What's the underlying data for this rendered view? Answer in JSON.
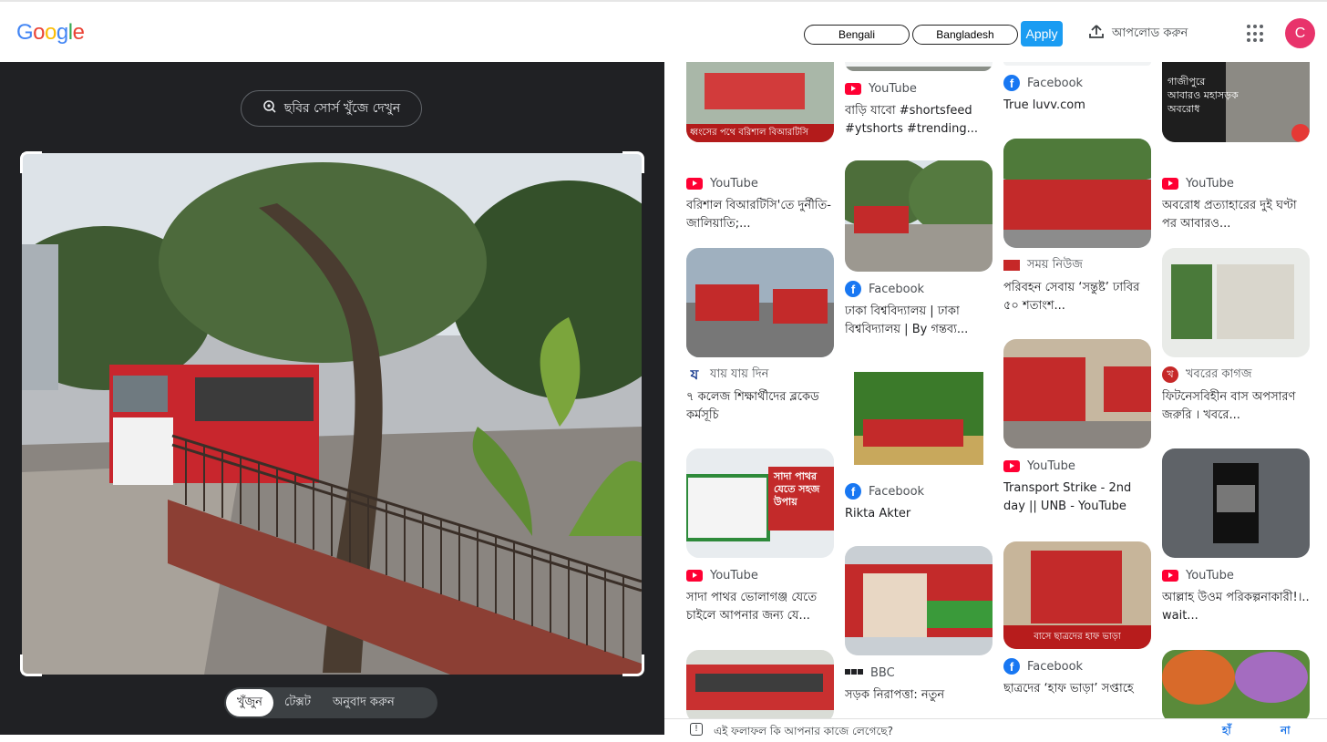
{
  "header": {
    "logo_text": "Google",
    "language_value": "Bengali",
    "region_value": "Bangladesh",
    "apply_label": "Apply",
    "upload_label": "আপলোড করুন",
    "avatar_letter": "C"
  },
  "left_panel": {
    "source_button_label": "ছবির সোর্স খুঁজে দেখুন",
    "tabs": [
      {
        "label": "খুঁজুন",
        "active": true
      },
      {
        "label": "টেক্সট",
        "active": false
      },
      {
        "label": "অনুবাদ করুন",
        "active": false
      }
    ]
  },
  "results": {
    "col1": [
      {
        "source": "",
        "icon": "none",
        "title": "",
        "caption": "ধ্বংসের পথে বরিশাল বিআরটিসি"
      },
      {
        "source": "YouTube",
        "icon": "youtube-icon",
        "title": "বরিশাল বিআরটিসি'তে দুর্নীতি-জালিয়াতি;..."
      },
      {
        "source": "যায় যায় দিন",
        "icon": "jaijaidin-icon",
        "title": "৭ কলেজ শিক্ষার্থীদের ব্লকেড কর্মসূচি"
      },
      {
        "source": "YouTube",
        "icon": "youtube-icon",
        "title": "সাদা পাথর ভোলাগঞ্জ যেতে চাইলে আপনার জন্য যে...",
        "caption": "সাদা পাথর যেতে সহজ উপায়"
      },
      {
        "source": "",
        "icon": "none",
        "title": ""
      }
    ],
    "col2": [
      {
        "source": "YouTube",
        "icon": "youtube-icon",
        "title": "বাড়ি যাবো #shortsfeed #ytshorts #trending..."
      },
      {
        "source": "Facebook",
        "icon": "facebook-icon",
        "title": "ঢাকা বিশ্ববিদ্যালয় | ঢাকা বিশ্ববিদ্যালয় | By গন্তব্য..."
      },
      {
        "source": "Facebook",
        "icon": "facebook-icon",
        "title": "Rikta Akter"
      },
      {
        "source": "BBC",
        "icon": "bbc-icon",
        "title": "সড়ক নিরাপত্তা: নতুন"
      }
    ],
    "col3": [
      {
        "source": "Facebook",
        "icon": "facebook-icon",
        "title": "True luvv.com"
      },
      {
        "source": "সময় নিউজ",
        "icon": "somoy-icon",
        "title": "পরিবহন সেবায় ‘সন্তুষ্ট’ ঢাবির ৫০ শতাংশ..."
      },
      {
        "source": "YouTube",
        "icon": "youtube-icon",
        "title": "Transport Strike - 2nd day || UNB - YouTube"
      },
      {
        "source": "Facebook",
        "icon": "facebook-icon",
        "title": "ছাত্রদের ‘হাফ ভাড়া’ সপ্তাহে",
        "caption": "বাসে ছাত্রদের হাফ ভাড়া"
      }
    ],
    "col4": [
      {
        "source": "",
        "icon": "none",
        "title": "",
        "caption": "গাজীপুরে আবারও মহাসড়ক অবরোধ"
      },
      {
        "source": "YouTube",
        "icon": "youtube-icon",
        "title": "অবরোধ প্রত্যাহারের দুই ঘণ্টা পর আবারও..."
      },
      {
        "source": "খবরের কাগজ",
        "icon": "khoborer-kagoj-icon",
        "title": "ফিটনেসবিহীন বাস অপসারণ জরুরি । খবরে..."
      },
      {
        "source": "YouTube",
        "icon": "youtube-icon",
        "title": "আল্লাহ উওম পরিকল্পনাকারী!।.. wait..."
      },
      {
        "source": "",
        "icon": "none",
        "title": ""
      }
    ]
  },
  "feedback": {
    "question": "এই ফলাফল কি আপনার কাজে লেগেছে?",
    "yes": "হাঁ",
    "no": "না"
  },
  "colors": {
    "accent": "#1a73e8",
    "apply_bg": "#1a9cf2",
    "avatar_bg": "#e8336b",
    "left_bg": "#202124"
  }
}
